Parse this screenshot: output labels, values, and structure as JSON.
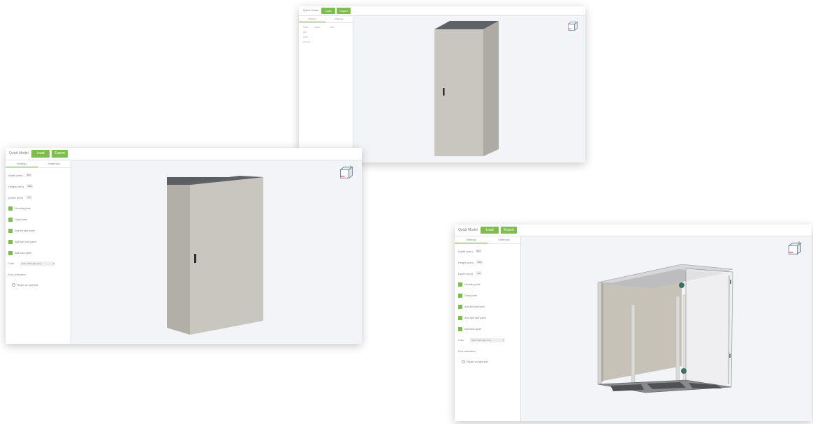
{
  "app": {
    "title": "Quick Model",
    "load_label": "Load",
    "export_label": "Export"
  },
  "tabs": {
    "settings": "Settings",
    "materials": "Materials"
  },
  "fields": {
    "width": {
      "label": "Width (mm)",
      "value": "800"
    },
    "height": {
      "label": "Height (mm)",
      "value": "1800"
    },
    "depth": {
      "label": "Depth (mm)",
      "value": "400"
    }
  },
  "checkboxes": [
    "Mounting plate",
    "Gland plate",
    "Add left side panel",
    "Add right side panel",
    "Add back panel"
  ],
  "color": {
    "label": "Color",
    "value": "RAL 7035 Light Grey"
  },
  "orientation": {
    "label": "Door orientation",
    "option": "Hinges on right side"
  },
  "top_sidebar": {
    "cols": [
      "Width",
      "Height"
    ],
    "row_labels": [
      "800",
      "1800",
      "Options"
    ],
    "material": "Steel"
  },
  "icons": {
    "checkbox": "checkmark-icon",
    "view_cube": "view-cube-icon",
    "dropdown": "chevron-down-icon"
  },
  "colors": {
    "accent": "#7dbd49",
    "viewport": "#f3f4f8",
    "cabinet": "#c9c6bf"
  }
}
